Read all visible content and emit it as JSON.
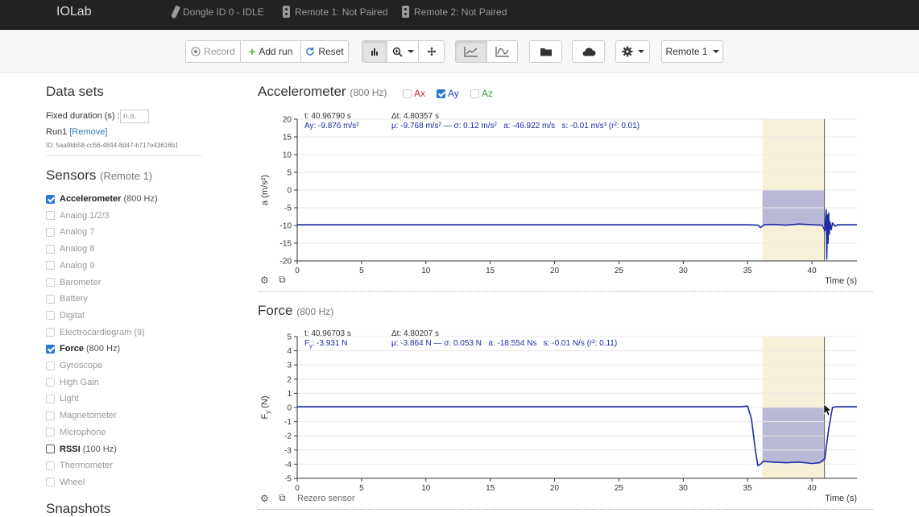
{
  "app": {
    "title": "IOLab"
  },
  "status": {
    "dongle": "Dongle ID 0 - IDLE",
    "remote1": "Remote 1: Not Paired",
    "remote2": "Remote 2: Not Paired"
  },
  "toolbar": {
    "record": "Record",
    "add_run": "Add run",
    "reset": "Reset",
    "remote_select": "Remote 1"
  },
  "sidebar": {
    "datasets_title": "Data sets",
    "fixed_duration_label": "Fixed duration (s) :",
    "fixed_duration_placeholder": "n.a.",
    "run_name": "Run1",
    "remove_link": "[Remove]",
    "run_id": "ID: 5aa9bb58-cc56-4844-8d47-b717e43616b1",
    "sensors_title": "Sensors",
    "sensors_remote": "(Remote 1)",
    "snapshots_title": "Snapshots",
    "sensors": [
      {
        "name": "Accelerometer",
        "rate": "(800 Hz)",
        "checked": true,
        "bold": true
      },
      {
        "name": "Analog 1/2/3",
        "rate": "",
        "checked": false,
        "bold": false
      },
      {
        "name": "Analog 7",
        "rate": "",
        "checked": false,
        "bold": false
      },
      {
        "name": "Analog 8",
        "rate": "",
        "checked": false,
        "bold": false
      },
      {
        "name": "Analog 9",
        "rate": "",
        "checked": false,
        "bold": false
      },
      {
        "name": "Barometer",
        "rate": "",
        "checked": false,
        "bold": false
      },
      {
        "name": "Battery",
        "rate": "",
        "checked": false,
        "bold": false
      },
      {
        "name": "Digital",
        "rate": "",
        "checked": false,
        "bold": false
      },
      {
        "name": "Electrocardiogram (9)",
        "rate": "",
        "checked": false,
        "bold": false
      },
      {
        "name": "Force",
        "rate": "(800 Hz)",
        "checked": true,
        "bold": true
      },
      {
        "name": "Gyroscope",
        "rate": "",
        "checked": false,
        "bold": false
      },
      {
        "name": "High Gain",
        "rate": "",
        "checked": false,
        "bold": false
      },
      {
        "name": "Light",
        "rate": "",
        "checked": false,
        "bold": false
      },
      {
        "name": "Magnetometer",
        "rate": "",
        "checked": false,
        "bold": false
      },
      {
        "name": "Microphone",
        "rate": "",
        "checked": false,
        "bold": false
      },
      {
        "name": "RSSI",
        "rate": "(100 Hz)",
        "checked": false,
        "bold": true
      },
      {
        "name": "Thermometer",
        "rate": "",
        "checked": false,
        "bold": false
      },
      {
        "name": "Wheel",
        "rate": "",
        "checked": false,
        "bold": false
      }
    ]
  },
  "accel": {
    "title": "Accelerometer",
    "rate": "(800 Hz)",
    "ax": "Ax",
    "ay": "Ay",
    "az": "Az",
    "cursor_t": "t: 40.96790 s",
    "cursor_dt": "Δt: 4.80357 s",
    "value_label": "Ay: -9.876 m/s²",
    "stats": "μ: -9.768 m/s² — σ: 0.12 m/s²   a: -46.922 m/s   s: -0.01 m/s³ (r²: 0.01)"
  },
  "force": {
    "title": "Force",
    "rate": "(800 Hz)",
    "cursor_t": "t: 40.96703 s",
    "cursor_dt": "Δt: 4.80207 s",
    "value_label_main": "F",
    "value_label_sub": "y",
    "value_label_rest": ": -3.931 N",
    "stats": "μ: -3.864 N — σ: 0.053 N   a: -18.554 Ns   s: -0.01 N/s (r²: 0.11)",
    "rezero": "Rezero sensor"
  },
  "chart_data": [
    {
      "type": "line",
      "xlabel": "Time (s)",
      "ylabel": "a (m/s²)",
      "xlim": [
        0,
        43.5
      ],
      "ylim": [
        -20,
        20
      ],
      "x_ticks": [
        0,
        5,
        10,
        15,
        20,
        25,
        30,
        35,
        40
      ],
      "y_ticks": [
        20,
        15,
        10,
        5,
        0,
        -5,
        -10,
        -15,
        -20
      ],
      "selection": [
        36.16,
        40.97
      ],
      "cursor": 40.97,
      "series": [
        {
          "color": "#1c2aa6",
          "x": [
            0,
            5,
            10,
            15,
            20,
            25,
            30,
            35,
            35.8,
            36.0,
            36.3,
            37,
            38,
            39,
            40,
            40.8,
            41.0,
            41.1,
            41.15,
            41.2,
            41.25,
            41.3,
            41.35,
            41.4,
            41.5,
            41.6,
            41.8,
            42,
            43.5
          ],
          "y": [
            -9.8,
            -9.8,
            -9.8,
            -9.8,
            -9.8,
            -9.8,
            -9.8,
            -9.8,
            -9.9,
            -10.6,
            -9.8,
            -9.7,
            -9.9,
            -9.6,
            -9.8,
            -9.9,
            -11.5,
            -5.5,
            -19.5,
            -7.0,
            -15.0,
            -6.5,
            -12.5,
            -9.0,
            -11.2,
            -9.3,
            -10.2,
            -9.8,
            -9.8
          ]
        }
      ]
    },
    {
      "type": "line",
      "xlabel": "Time (s)",
      "ylabel": "F",
      "xlim": [
        0,
        43.5
      ],
      "ylim": [
        -5,
        5
      ],
      "x_ticks": [
        0,
        5,
        10,
        15,
        20,
        25,
        30,
        35,
        40
      ],
      "y_ticks": [
        5,
        4,
        3,
        2,
        1,
        0,
        -1,
        -2,
        -3,
        -4,
        -5
      ],
      "selection": [
        36.16,
        40.97
      ],
      "cursor": 40.97,
      "series": [
        {
          "color": "#1c2aa6",
          "x": [
            0,
            5,
            10,
            15,
            20,
            25,
            30,
            34.5,
            35.0,
            35.3,
            35.6,
            35.8,
            36.0,
            36.2,
            37,
            38,
            39,
            40,
            40.6,
            41.0,
            41.3,
            41.6,
            41.9,
            42.5,
            43.5
          ],
          "y": [
            0.05,
            0.05,
            0.05,
            0.05,
            0.05,
            0.05,
            0.05,
            0.05,
            0.1,
            -0.8,
            -3.0,
            -4.1,
            -4.0,
            -3.8,
            -3.85,
            -3.9,
            -3.85,
            -3.95,
            -3.9,
            -3.6,
            -1.5,
            0.0,
            0.05,
            0.05,
            0.05
          ]
        }
      ]
    }
  ]
}
